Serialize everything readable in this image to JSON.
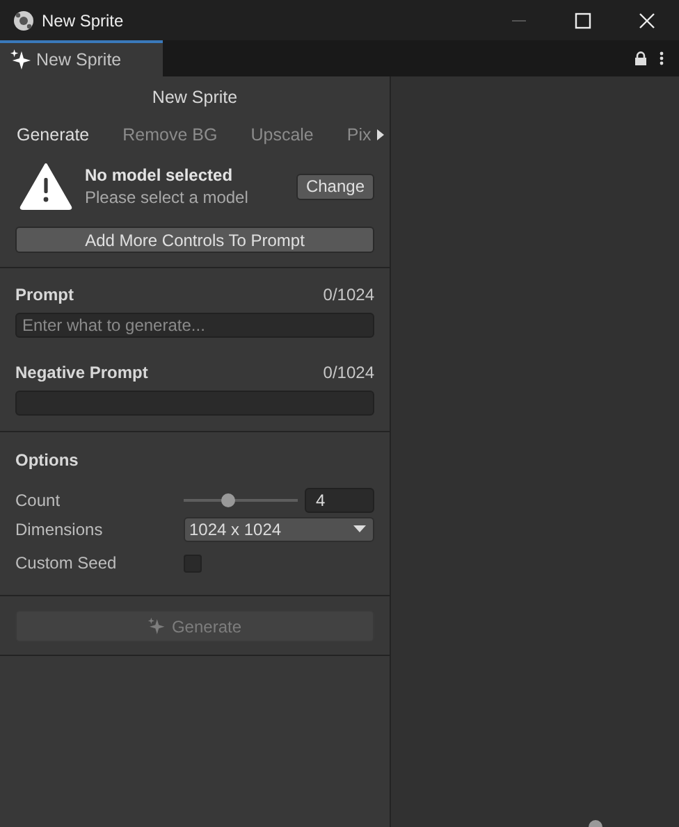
{
  "window": {
    "title": "New Sprite"
  },
  "dock_tab": {
    "label": "New Sprite",
    "selected": true
  },
  "panel": {
    "title": "New Sprite"
  },
  "tabs": [
    {
      "label": "Generate",
      "selected": true
    },
    {
      "label": "Remove BG",
      "selected": false
    },
    {
      "label": "Upscale",
      "selected": false
    },
    {
      "label": "Pix",
      "selected": false
    }
  ],
  "model_warning": {
    "title": "No model selected",
    "message": "Please select a model",
    "button": "Change"
  },
  "add_controls_button": "Add More Controls To Prompt",
  "prompt": {
    "label": "Prompt",
    "counter": "0/1024",
    "placeholder": "Enter what to generate..."
  },
  "negative_prompt": {
    "label": "Negative Prompt",
    "counter": "0/1024"
  },
  "options": {
    "title": "Options",
    "count": {
      "label": "Count",
      "level": 0.39,
      "value": "4"
    },
    "dimensions": {
      "label": "Dimensions",
      "value": "1024 x 1024"
    },
    "custom_seed": {
      "label": "Custom Seed",
      "checked": false
    }
  },
  "generate_button": {
    "label": "Generate",
    "disabled": true
  }
}
